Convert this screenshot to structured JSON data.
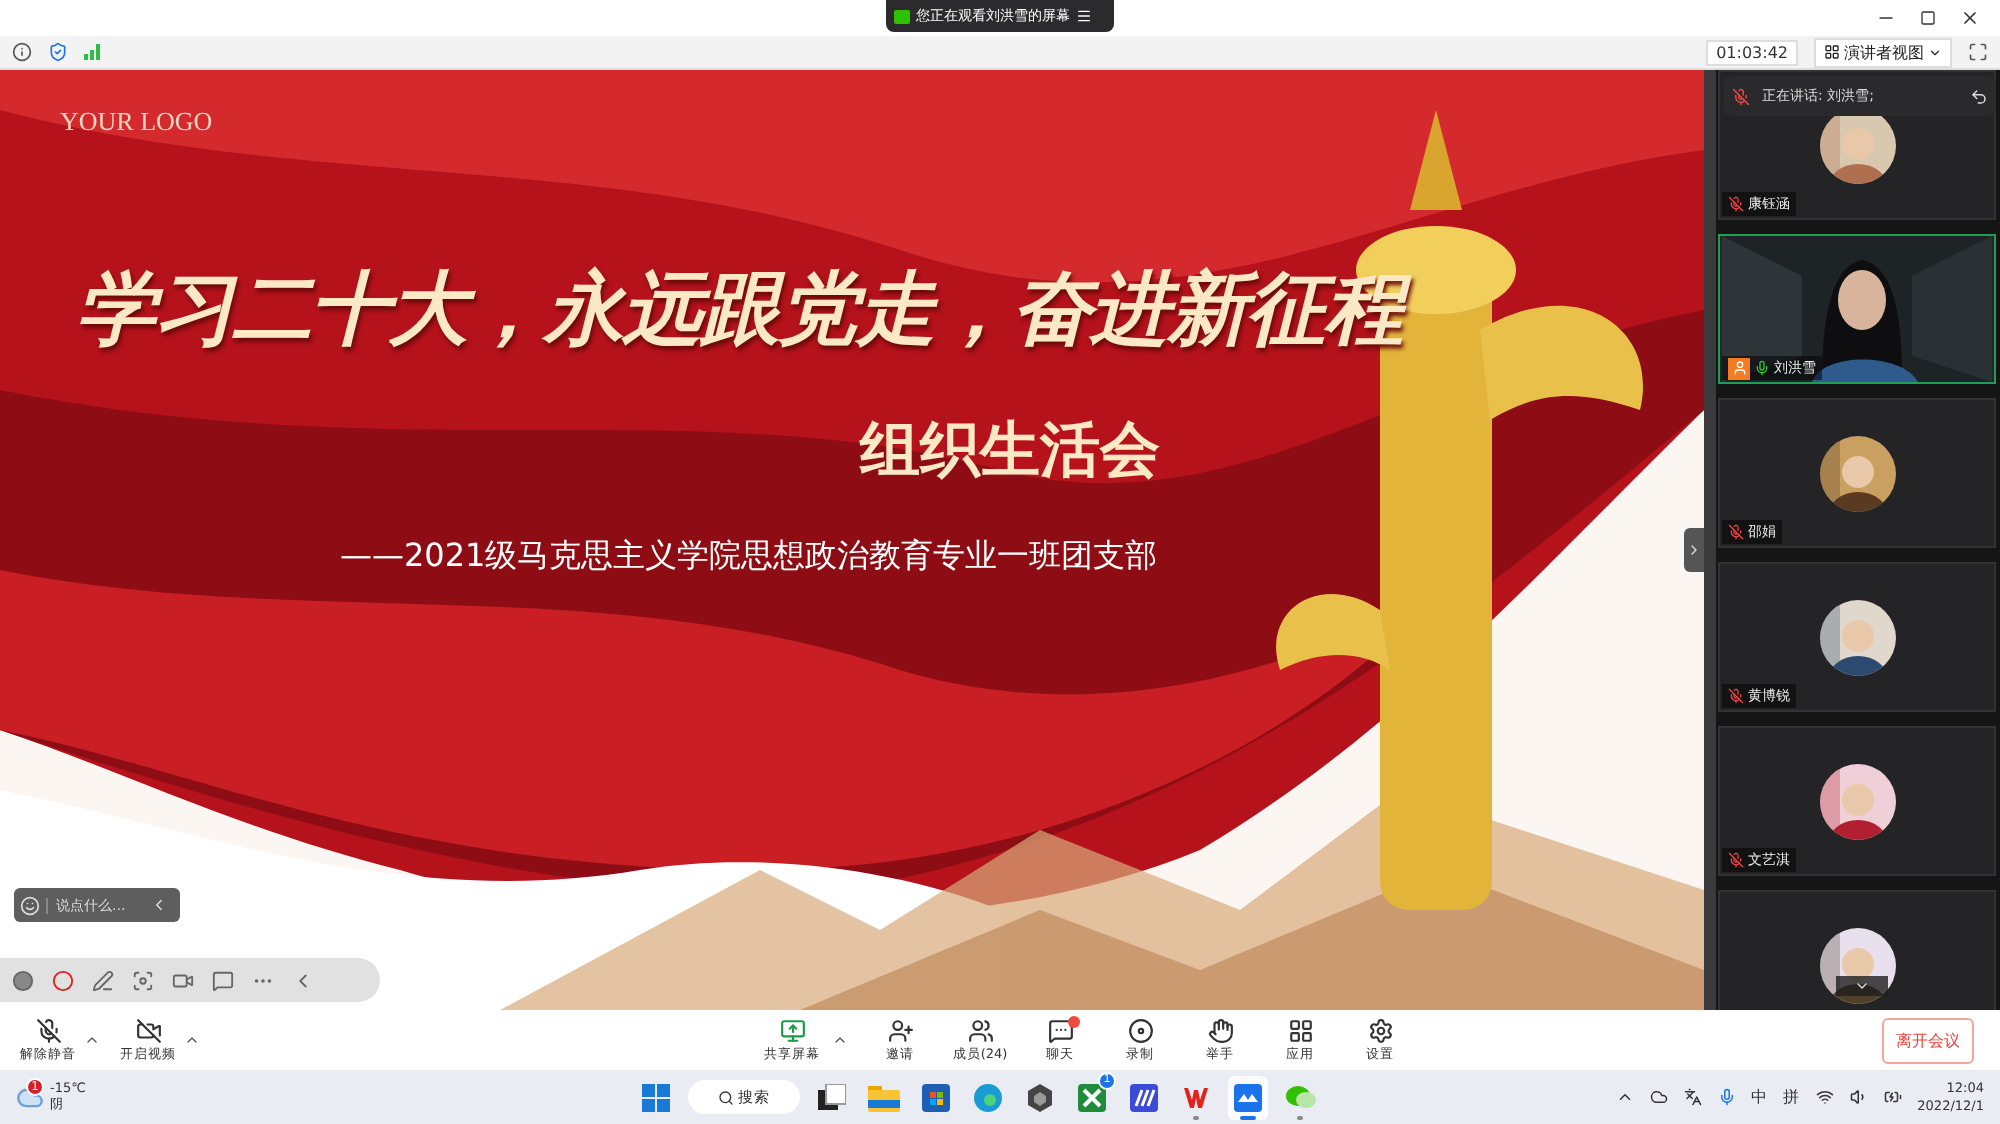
{
  "window": {
    "banner": "您正在观看刘洪雪的屏幕"
  },
  "meeting_bar": {
    "timer": "01:03:42",
    "view_button": "演讲者视图"
  },
  "slide": {
    "logo": "YOUR LOGO",
    "title": "学习二十大，永远跟党走，奋进新征程",
    "subtitle": "组织生活会",
    "byline": "——2021级马克思主义学院思想政治教育专业一班团支部"
  },
  "comment": {
    "placeholder": "说点什么..."
  },
  "speaker_banner": {
    "label": "正在讲话: 刘洪雪;"
  },
  "participants": [
    {
      "name": "康钰涵",
      "kind": "avatar",
      "muted": true,
      "speaking": false,
      "host": false
    },
    {
      "name": "刘洪雪",
      "kind": "video",
      "muted": false,
      "speaking": true,
      "host": true
    },
    {
      "name": "邵娟",
      "kind": "avatar",
      "muted": true,
      "speaking": false,
      "host": false
    },
    {
      "name": "黄博锐",
      "kind": "avatar",
      "muted": true,
      "speaking": false,
      "host": false
    },
    {
      "name": "文艺淇",
      "kind": "avatar",
      "muted": true,
      "speaking": false,
      "host": false
    },
    {
      "kind": "avatar",
      "speaking": false
    }
  ],
  "toolbar": {
    "left": [
      {
        "label": "解除静音",
        "kind": "mic",
        "menu": true
      },
      {
        "label": "开启视频",
        "kind": "camera",
        "menu": true
      }
    ],
    "center": [
      {
        "label": "共享屏幕",
        "kind": "share",
        "menu": true
      },
      {
        "label": "邀请",
        "kind": "invite"
      },
      {
        "label": "成员(24)",
        "kind": "members"
      },
      {
        "label": "聊天",
        "kind": "chat",
        "badge": true
      },
      {
        "label": "录制",
        "kind": "record"
      },
      {
        "label": "举手",
        "kind": "hand"
      },
      {
        "label": "应用",
        "kind": "apps"
      },
      {
        "label": "设置",
        "kind": "settings"
      }
    ],
    "leave": "离开会议"
  },
  "taskbar": {
    "weather": {
      "badge": "1",
      "temperature": "-15℃",
      "condition": "阴"
    },
    "search": "搜索",
    "apps": [
      {
        "kind": "start",
        "running": false
      },
      {
        "kind": "search"
      },
      {
        "kind": "taskview",
        "running": false
      },
      {
        "kind": "folder",
        "running": false
      },
      {
        "kind": "store",
        "running": false
      },
      {
        "kind": "edge",
        "running": false
      },
      {
        "kind": "cube",
        "running": false
      },
      {
        "kind": "xbox",
        "running": false,
        "badge": "1"
      },
      {
        "kind": "editor",
        "running": false
      },
      {
        "kind": "wps",
        "running": true
      },
      {
        "kind": "meeting",
        "running": true
      },
      {
        "kind": "chat",
        "running": true
      }
    ],
    "tray": {
      "ime_lang": "中",
      "ime_mode": "拼",
      "time": "12:04",
      "date": "2022/12/1"
    }
  }
}
